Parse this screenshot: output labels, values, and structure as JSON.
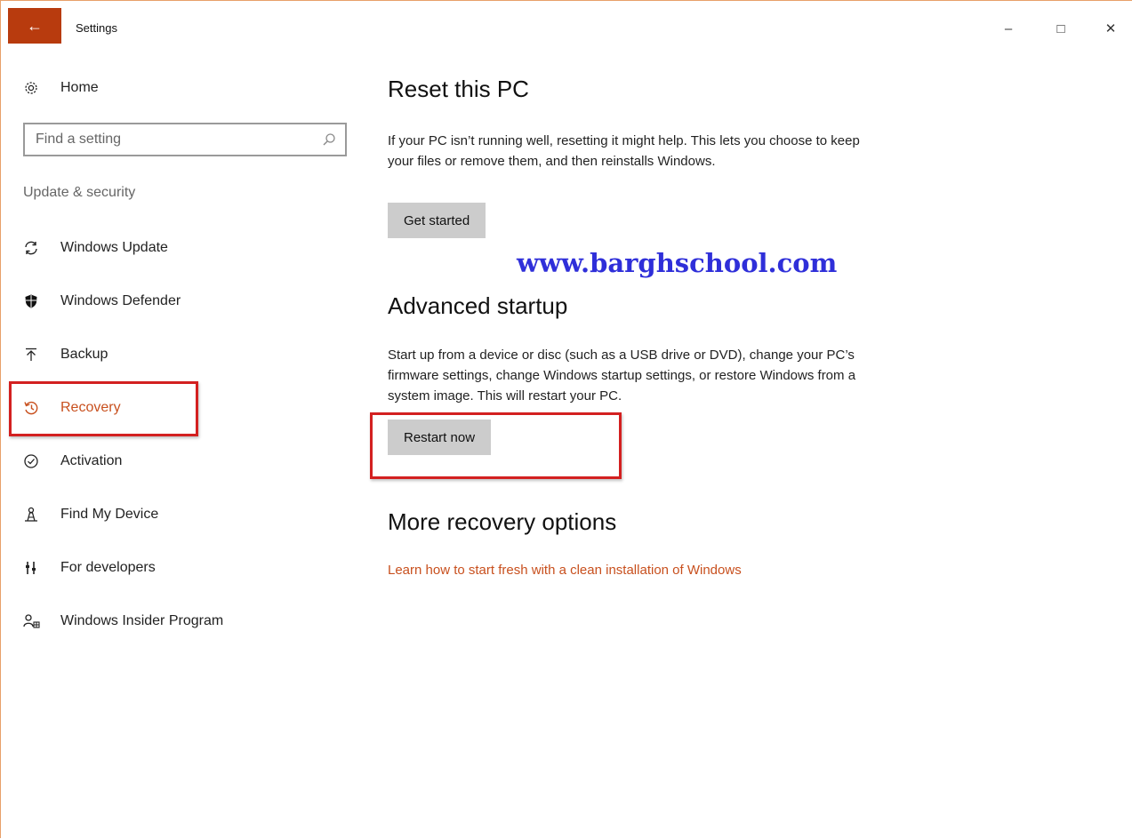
{
  "window": {
    "title": "Settings",
    "back_icon": "←",
    "minimize_icon": "–",
    "maximize_icon": "□",
    "close_icon": "✕"
  },
  "sidebar": {
    "home_label": "Home",
    "search_placeholder": "Find a setting",
    "section_label": "Update & security",
    "items": [
      {
        "label": "Windows Update",
        "icon": "sync-icon"
      },
      {
        "label": "Windows Defender",
        "icon": "shield-icon"
      },
      {
        "label": "Backup",
        "icon": "backup-icon"
      },
      {
        "label": "Recovery",
        "icon": "recovery-icon",
        "active": true
      },
      {
        "label": "Activation",
        "icon": "activation-icon"
      },
      {
        "label": "Find My Device",
        "icon": "find-device-icon"
      },
      {
        "label": "For developers",
        "icon": "developers-icon"
      },
      {
        "label": "Windows Insider Program",
        "icon": "insider-icon"
      }
    ]
  },
  "main": {
    "reset": {
      "title": "Reset this PC",
      "description": "If your PC isn’t running well, resetting it might help. This lets you choose to keep your files or remove them, and then reinstalls Windows.",
      "button": "Get started"
    },
    "advanced": {
      "title": "Advanced startup",
      "description": "Start up from a device or disc (such as a USB drive or DVD), change your PC’s firmware settings, change Windows startup settings, or restore Windows from a system image. This will restart your PC.",
      "button": "Restart now"
    },
    "more": {
      "title": "More recovery options",
      "link": "Learn how to start fresh with a clean installation of Windows"
    }
  },
  "watermark": "www.barghschool.com",
  "colors": {
    "accent": "#c8501e",
    "back_button": "#b83b0e",
    "highlight": "#d32020",
    "watermark": "#2f2fd9"
  }
}
